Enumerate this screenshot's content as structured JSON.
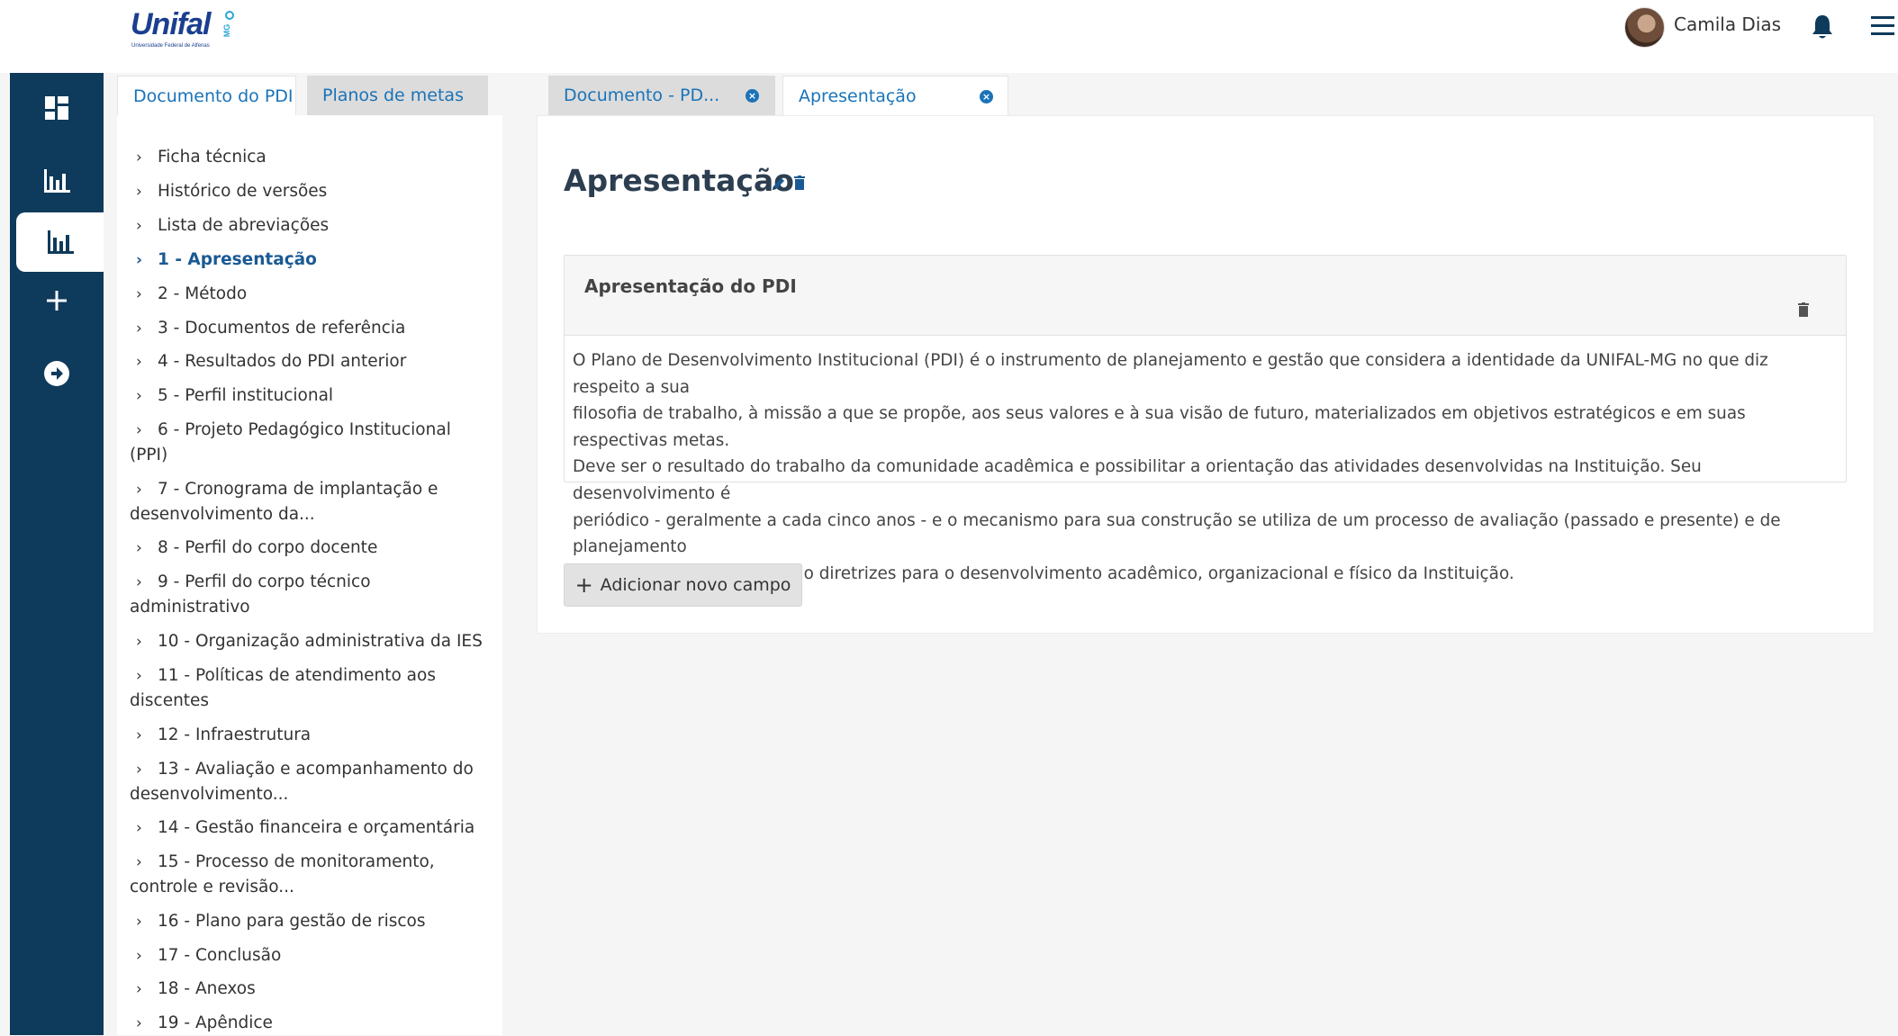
{
  "header": {
    "logo_text": "Unifal",
    "logo_badge": "MG",
    "logo_subtitle": "Universidade Federal de Alfenas",
    "user_name": "Camila Dias"
  },
  "sidebar": {
    "items": [
      {
        "icon": "dashboard-icon",
        "active": false
      },
      {
        "icon": "bar-chart-icon",
        "active": false
      },
      {
        "icon": "bar-chart-icon",
        "active": true
      },
      {
        "icon": "plus-icon",
        "active": false
      },
      {
        "icon": "arrow-circle-right-icon",
        "active": false
      }
    ]
  },
  "left_tabs": [
    "Documento do PDI",
    "Planos de metas"
  ],
  "tree": {
    "items": [
      {
        "label": "Ficha técnica"
      },
      {
        "label": "Histórico de versões"
      },
      {
        "label": "Lista de abreviações"
      },
      {
        "label": "1 - Apresentação",
        "active": true
      },
      {
        "label": "2 - Método"
      },
      {
        "label": "3 - Documentos de referência"
      },
      {
        "label": "4 - Resultados do PDI anterior"
      },
      {
        "label": "5 - Perfil institucional"
      },
      {
        "label": "6 - Projeto Pedagógico Institucional",
        "label2": "(PPI)"
      },
      {
        "label": "7 - Cronograma de implantação e",
        "label2": "desenvolvimento da..."
      },
      {
        "label": "8 - Perfil do corpo docente"
      },
      {
        "label": "9 - Perfil do corpo técnico",
        "label2": "administrativo"
      },
      {
        "label": "10 - Organização administrativa da IES"
      },
      {
        "label": "11 - Políticas de atendimento aos",
        "label2": "discentes"
      },
      {
        "label": "12 - Infraestrutura"
      },
      {
        "label": "13 - Avaliação e acompanhamento do",
        "label2": "desenvolvimento..."
      },
      {
        "label": "14 - Gestão financeira e orçamentária"
      },
      {
        "label": "15 - Processo de monitoramento,",
        "label2": "controle e revisão..."
      },
      {
        "label": "16 - Plano para gestão de riscos"
      },
      {
        "label": "17 - Conclusão"
      },
      {
        "label": "18 - Anexos"
      },
      {
        "label": "19 - Apêndice"
      }
    ]
  },
  "doc_tabs": [
    {
      "label": "Documento - PD...",
      "active": false
    },
    {
      "label": "Apresentação",
      "active": true
    }
  ],
  "main": {
    "title": "Apresentação",
    "field": {
      "title": "Apresentação do PDI",
      "lines": [
        "O Plano de Desenvolvimento Institucional (PDI) é o instrumento de planejamento e gestão que considera a identidade da UNIFAL-MG no que diz respeito a sua",
        "filosofia de trabalho, à missão a que se propõe, aos seus valores e à sua visão de futuro, materializados em objetivos estratégicos e em suas respectivas metas.",
        "Deve ser o resultado do trabalho da comunidade acadêmica e possibilitar a orientação das atividades desenvolvidas na Instituição. Seu desenvolvimento é",
        "periódico - geralmente a cada cinco anos - e o mecanismo para sua construção se utiliza de um processo de avaliação (passado e presente) e de planejamento",
        "com foco no futuro, traçando diretrizes para o desenvolvimento acadêmico, organizacional e físico da Instituição."
      ]
    },
    "add_button_label": "Adicionar novo campo"
  },
  "colors": {
    "sidebar_bg": "#0e3a5b",
    "link_blue": "#1a73b8",
    "active_tree": "#1a5a94"
  }
}
